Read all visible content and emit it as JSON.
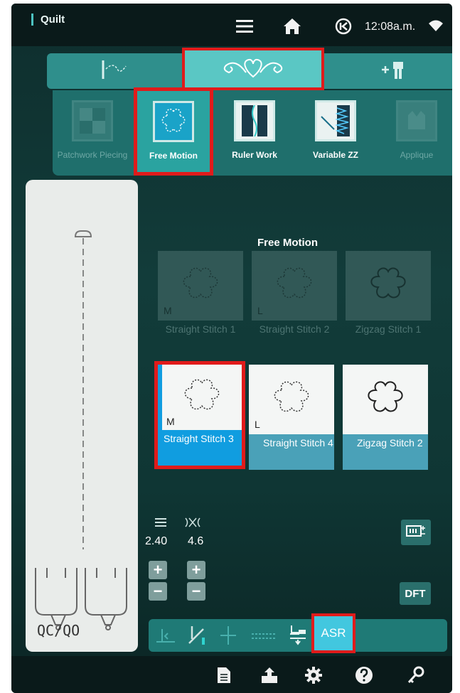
{
  "status_bar": {
    "app_title": "Quilt",
    "time": "12:08a.m.",
    "icons": [
      "menu-icon",
      "home-icon",
      "back-icon",
      "wifi-icon"
    ]
  },
  "tabs": [
    {
      "name": "stitch-tab",
      "icon": "needle-thread-icon",
      "active": false
    },
    {
      "name": "quilt-tab",
      "icon": "heart-flourish-icon",
      "active": true
    },
    {
      "name": "accessory-tab",
      "icon": "presser-foot-plus-icon",
      "active": false
    }
  ],
  "techniques": [
    {
      "label": "Patchwork Piecing",
      "icon": "patchwork-icon",
      "enabled": false,
      "selected": false
    },
    {
      "label": "Free Motion",
      "icon": "free-motion-icon",
      "enabled": true,
      "selected": true
    },
    {
      "label": "Ruler Work",
      "icon": "ruler-work-icon",
      "enabled": true,
      "selected": false
    },
    {
      "label": "Variable ZZ",
      "icon": "variable-zz-icon",
      "enabled": true,
      "selected": false
    },
    {
      "label": "Applique",
      "icon": "applique-icon",
      "enabled": false,
      "selected": false
    }
  ],
  "preview": {
    "foot_label": "QC/QO"
  },
  "section_title": "Free Motion",
  "stitches": [
    {
      "corner": "M",
      "label": "Straight Stitch 1",
      "state": "disabled"
    },
    {
      "corner": "L",
      "label": "Straight Stitch 2",
      "state": "disabled"
    },
    {
      "corner": "",
      "label": "Zigzag Stitch 1",
      "state": "disabled"
    },
    {
      "corner": "M",
      "label": "Straight Stitch 3",
      "state": "selected"
    },
    {
      "corner": "L",
      "label": "Straight Stitch 4",
      "state": "normal"
    },
    {
      "corner": "",
      "label": "Zigzag Stitch 2",
      "state": "normal"
    }
  ],
  "params": {
    "length": {
      "icon": "stitch-length-icon",
      "value": "2.40"
    },
    "width": {
      "icon": "stitch-width-icon",
      "value": "4.6"
    },
    "plus": "+",
    "minus": "−"
  },
  "side_buttons": {
    "dft": "DFT",
    "settings_icon": "stitch-settings-icon"
  },
  "toolbar": {
    "icons": [
      "tie-off-icon",
      "needle-stop-icon",
      "needle-position-icon",
      "feed-dog-icon",
      "presser-foot-lift-icon"
    ],
    "asr_label": "ASR"
  },
  "bottom_bar": {
    "icons": [
      "file-icon",
      "export-icon",
      "settings-icon",
      "help-icon",
      "key-icon"
    ]
  },
  "colors": {
    "accent": "#5ac7c4",
    "selected_tile": "#109de0",
    "highlight_box": "#e01b1b"
  }
}
